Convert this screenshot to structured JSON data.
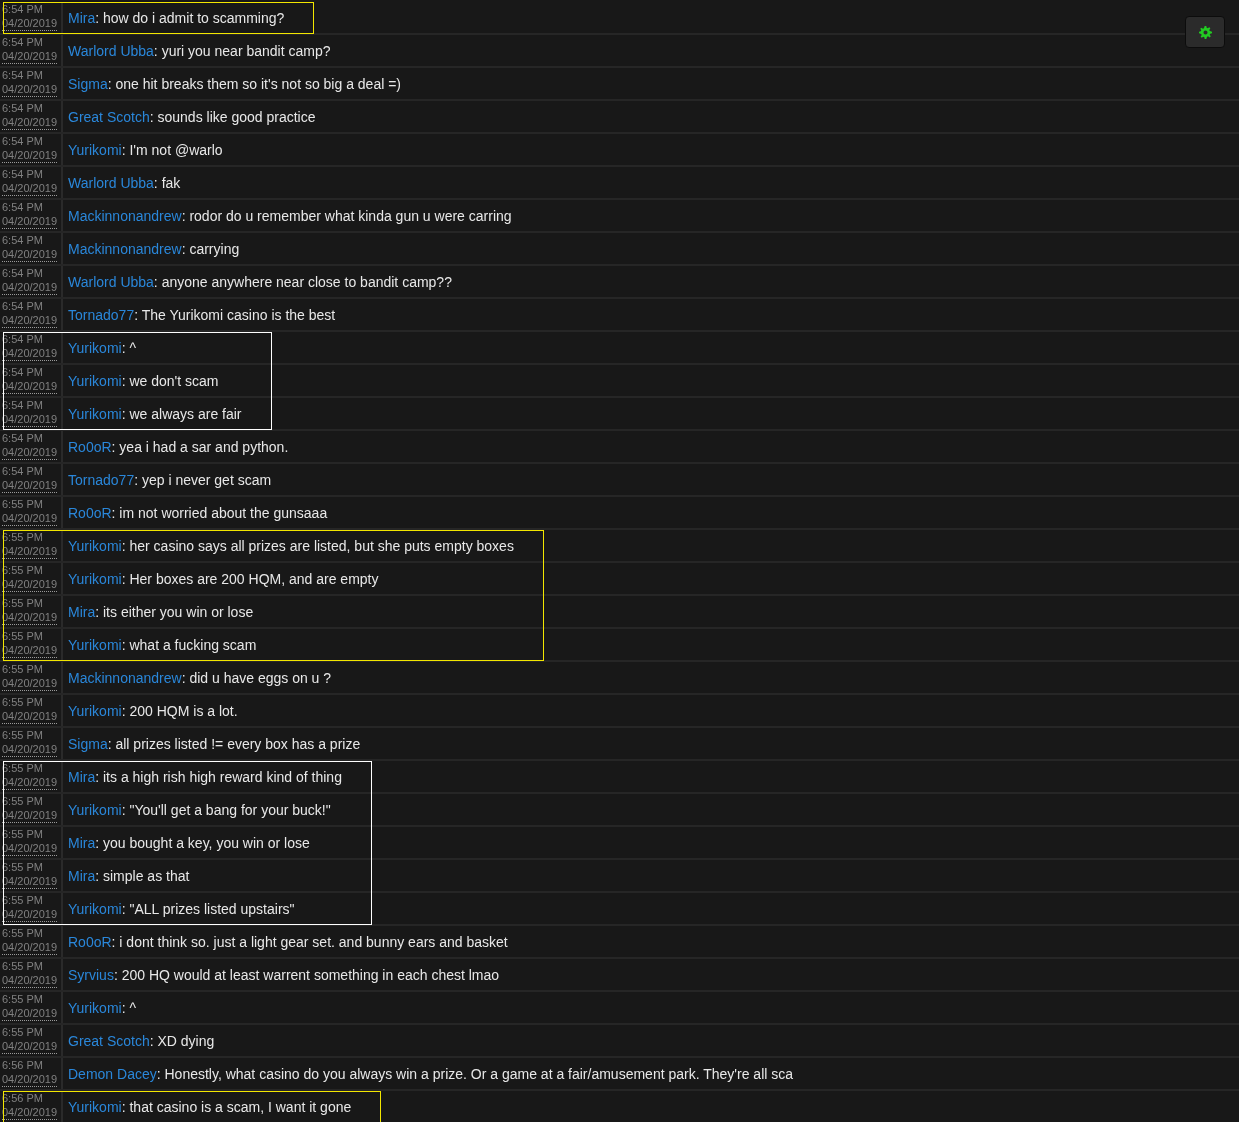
{
  "settings_button": {
    "kind": "gear"
  },
  "blocks": [
    {
      "color": "#f2e600",
      "messages": [
        {
          "time": "6:54 PM",
          "date": "04/20/2019",
          "user": "Mira",
          "text": ": how do i admit to scamming?"
        }
      ]
    },
    {
      "messages": [
        {
          "time": "6:54 PM",
          "date": "04/20/2019",
          "user": "Warlord Ubba",
          "text": ": yuri you near bandit camp?"
        },
        {
          "time": "6:54 PM",
          "date": "04/20/2019",
          "user": "Sigma",
          "text": ": one hit breaks them so it's not so big a deal =)"
        },
        {
          "time": "6:54 PM",
          "date": "04/20/2019",
          "user": "Great Scotch",
          "text": ": sounds like good practice"
        },
        {
          "time": "6:54 PM",
          "date": "04/20/2019",
          "user": "Yurikomi",
          "text": ": I'm not @warlo"
        },
        {
          "time": "6:54 PM",
          "date": "04/20/2019",
          "user": "Warlord Ubba",
          "text": ": fak"
        },
        {
          "time": "6:54 PM",
          "date": "04/20/2019",
          "user": "Mackinnonandrew",
          "text": ": rodor do u remember what kinda gun u were carring"
        },
        {
          "time": "6:54 PM",
          "date": "04/20/2019",
          "user": "Mackinnonandrew",
          "text": ": carrying"
        },
        {
          "time": "6:54 PM",
          "date": "04/20/2019",
          "user": "Warlord Ubba",
          "text": ": anyone anywhere near close to bandit camp??"
        },
        {
          "time": "6:54 PM",
          "date": "04/20/2019",
          "user": "Tornado77",
          "text": ": The Yurikomi casino is the best"
        }
      ]
    },
    {
      "color": "#ffffff",
      "messages": [
        {
          "time": "6:54 PM",
          "date": "04/20/2019",
          "user": "Yurikomi",
          "text": ": ^"
        },
        {
          "time": "6:54 PM",
          "date": "04/20/2019",
          "user": "Yurikomi",
          "text": ": we don't scam"
        },
        {
          "time": "6:54 PM",
          "date": "04/20/2019",
          "user": "Yurikomi",
          "text": ": we always are fair"
        }
      ]
    },
    {
      "messages": [
        {
          "time": "6:54 PM",
          "date": "04/20/2019",
          "user": "Ro0oR",
          "text": ": yea i had a sar and python."
        },
        {
          "time": "6:54 PM",
          "date": "04/20/2019",
          "user": "Tornado77",
          "text": ": yep i never get scam"
        },
        {
          "time": "6:55 PM",
          "date": "04/20/2019",
          "user": "Ro0oR",
          "text": ": im not worried about the gunsaaa"
        }
      ]
    },
    {
      "color": "#f2e600",
      "messages": [
        {
          "time": "6:55 PM",
          "date": "04/20/2019",
          "user": "Yurikomi",
          "text": ": her casino says all prizes are listed, but she puts empty boxes"
        },
        {
          "time": "6:55 PM",
          "date": "04/20/2019",
          "user": "Yurikomi",
          "text": ": Her boxes are 200 HQM, and are empty"
        },
        {
          "time": "6:55 PM",
          "date": "04/20/2019",
          "user": "Mira",
          "text": ": its either you win or lose"
        },
        {
          "time": "6:55 PM",
          "date": "04/20/2019",
          "user": "Yurikomi",
          "text": ": what a fucking scam"
        }
      ]
    },
    {
      "messages": [
        {
          "time": "6:55 PM",
          "date": "04/20/2019",
          "user": "Mackinnonandrew",
          "text": ": did u have eggs on u ?"
        },
        {
          "time": "6:55 PM",
          "date": "04/20/2019",
          "user": "Yurikomi",
          "text": ": 200 HQM is a lot."
        },
        {
          "time": "6:55 PM",
          "date": "04/20/2019",
          "user": "Sigma",
          "text": ": all prizes listed != every box has a prize"
        }
      ]
    },
    {
      "color": "#ffffff",
      "messages": [
        {
          "time": "6:55 PM",
          "date": "04/20/2019",
          "user": "Mira",
          "text": ": its a high rish high reward kind of thing"
        },
        {
          "time": "6:55 PM",
          "date": "04/20/2019",
          "user": "Yurikomi",
          "text": ": \"You'll get a bang for your buck!\""
        },
        {
          "time": "6:55 PM",
          "date": "04/20/2019",
          "user": "Mira",
          "text": ": you bought a key, you win or lose"
        },
        {
          "time": "6:55 PM",
          "date": "04/20/2019",
          "user": "Mira",
          "text": ": simple as that"
        },
        {
          "time": "6:55 PM",
          "date": "04/20/2019",
          "user": "Yurikomi",
          "text": ": \"ALL prizes listed upstairs\""
        }
      ]
    },
    {
      "messages": [
        {
          "time": "6:55 PM",
          "date": "04/20/2019",
          "user": "Ro0oR",
          "text": ": i dont think so. just a light gear set. and bunny ears and basket"
        },
        {
          "time": "6:55 PM",
          "date": "04/20/2019",
          "user": "Syrvius",
          "text": ": 200 HQ would at least warrent something in each chest lmao"
        },
        {
          "time": "6:55 PM",
          "date": "04/20/2019",
          "user": "Yurikomi",
          "text": ": ^"
        },
        {
          "time": "6:55 PM",
          "date": "04/20/2019",
          "user": "Great Scotch",
          "text": ": XD dying"
        },
        {
          "time": "6:56 PM",
          "date": "04/20/2019",
          "user": "Demon Dacey",
          "text": ": Honestly, what casino do you always win a prize. Or a game at a fair/amusement park. They're all sca"
        }
      ]
    },
    {
      "color": "#f2e600",
      "messages": [
        {
          "time": "6:56 PM",
          "date": "04/20/2019",
          "user": "Yurikomi",
          "text": ": that casino is a scam, I want it gone"
        }
      ]
    }
  ]
}
